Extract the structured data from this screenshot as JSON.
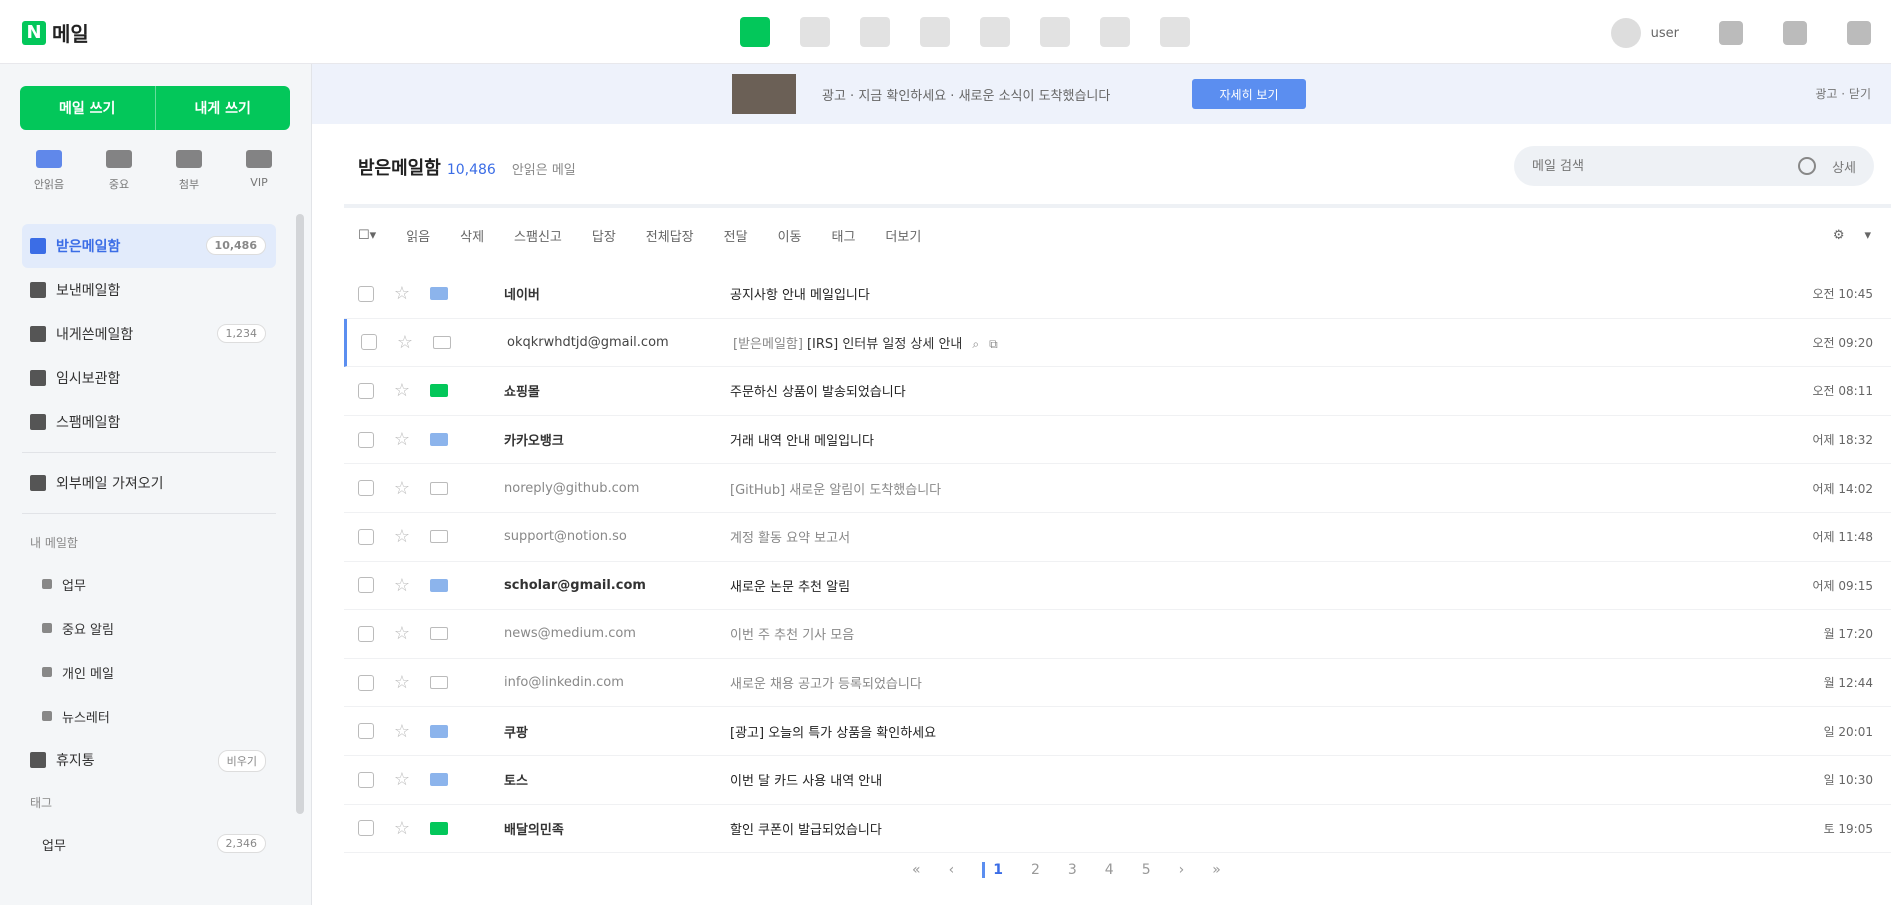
{
  "top": {
    "logo_letter": "N",
    "logo_text": "메일",
    "apps": [
      "mail",
      "calendar",
      "contacts",
      "memo",
      "todo",
      "drive",
      "photos",
      "more"
    ],
    "username": "user"
  },
  "sidebar": {
    "compose_label": "메일 쓰기",
    "self_compose_label": "내게 쓰기",
    "shortcuts": [
      {
        "label": "안읽음",
        "icon": "unread-icon"
      },
      {
        "label": "중요",
        "icon": "star-icon"
      },
      {
        "label": "첨부",
        "icon": "attach-icon"
      },
      {
        "label": "VIP",
        "icon": "vip-icon"
      }
    ],
    "folders": [
      {
        "label": "받은메일함",
        "count": "10,486",
        "active": true
      },
      {
        "label": "보낸메일함",
        "count": ""
      },
      {
        "label": "내게쓴메일함",
        "count": "1,234"
      },
      {
        "label": "임시보관함",
        "count": ""
      },
      {
        "label": "스팸메일함",
        "count": ""
      }
    ],
    "external": "외부메일 가져오기",
    "my_folders_head": "내 메일함",
    "subfolders": [
      "업무",
      "중요 알림",
      "개인 메일",
      "뉴스레터"
    ],
    "trash": {
      "label": "휴지통",
      "count": "비우기"
    },
    "tags_head": "태그",
    "tag_item": {
      "label": "업무",
      "count": "2,346"
    }
  },
  "banner": {
    "text": "광고 · 지금 확인하세요 · 새로운 소식이 도착했습니다",
    "button": "자세히 보기",
    "right": "광고 · 닫기"
  },
  "main": {
    "title": "받은메일함",
    "count": "10,486",
    "sub": "안읽은 메일",
    "search_placeholder": "메일 검색",
    "search_detail": "상세"
  },
  "toolbar": [
    "읽음",
    "삭제",
    "스팸신고",
    "답장",
    "전체답장",
    "전달",
    "이동",
    "태그",
    "더보기"
  ],
  "mails": [
    {
      "sender": "네이버",
      "subject": "공지사항 안내 메일입니다",
      "date": "오전 10:45",
      "type": "unread"
    },
    {
      "sender": "okqkrwhdtjd@gmail.com",
      "tag": "[받은메일함]",
      "subject": "[IRS] 인터뷰 일정 상세 안내",
      "date": "오전 09:20",
      "type": "hl"
    },
    {
      "sender": "쇼핑몰",
      "subject": "주문하신 상품이 발송되었습니다",
      "date": "오전 08:11",
      "type": "green"
    },
    {
      "sender": "카카오뱅크",
      "subject": "거래 내역 안내 메일입니다",
      "date": "어제 18:32",
      "type": "unread"
    },
    {
      "sender": "noreply@github.com",
      "subject": "[GitHub] 새로운 알림이 도착했습니다",
      "date": "어제 14:02",
      "type": "read"
    },
    {
      "sender": "support@notion.so",
      "subject": "계정 활동 요약 보고서",
      "date": "어제 11:48",
      "type": "read"
    },
    {
      "sender": "scholar@gmail.com",
      "subject": "새로운 논문 추천 알림",
      "date": "어제 09:15",
      "type": "unread"
    },
    {
      "sender": "news@medium.com",
      "subject": "이번 주 추천 기사 모음",
      "date": "월 17:20",
      "type": "read"
    },
    {
      "sender": "info@linkedin.com",
      "subject": "새로운 채용 공고가 등록되었습니다",
      "date": "월 12:44",
      "type": "read"
    },
    {
      "sender": "쿠팡",
      "subject": "[광고] 오늘의 특가 상품을 확인하세요",
      "date": "일 20:01",
      "type": "unread"
    },
    {
      "sender": "토스",
      "subject": "이번 달 카드 사용 내역 안내",
      "date": "일 10:30",
      "type": "unread"
    },
    {
      "sender": "배달의민족",
      "subject": "할인 쿠폰이 발급되었습니다",
      "date": "토 19:05",
      "type": "green"
    }
  ],
  "pager": [
    "«",
    "‹",
    "1",
    "2",
    "3",
    "4",
    "5",
    "›",
    "»"
  ]
}
